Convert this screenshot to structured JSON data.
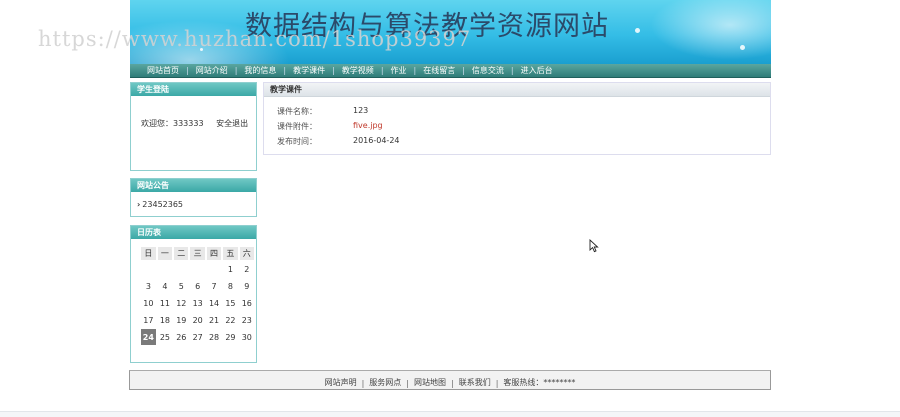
{
  "banner": {
    "title": "数据结构与算法教学资源网站"
  },
  "watermark": "https://www.huzhan.com/1shop39397",
  "nav": {
    "items": [
      "网站首页",
      "网站介绍",
      "我的信息",
      "教学课件",
      "教学视频",
      "作业",
      "在线留言",
      "信息交流",
      "进入后台"
    ]
  },
  "login": {
    "title": "学生登陆",
    "welcome": "欢迎您：333333",
    "logout": "安全退出"
  },
  "notice": {
    "title": "网站公告",
    "item": "23452365"
  },
  "calendar": {
    "title": "日历表",
    "weekdays": [
      "日",
      "一",
      "二",
      "三",
      "四",
      "五",
      "六"
    ],
    "weeks": [
      [
        "",
        "",
        "",
        "",
        "",
        "1",
        "2"
      ],
      [
        "3",
        "4",
        "5",
        "6",
        "7",
        "8",
        "9"
      ],
      [
        "10",
        "11",
        "12",
        "13",
        "14",
        "15",
        "16"
      ],
      [
        "17",
        "18",
        "19",
        "20",
        "21",
        "22",
        "23"
      ],
      [
        "24",
        "25",
        "26",
        "27",
        "28",
        "29",
        "30"
      ]
    ],
    "today": "24"
  },
  "main": {
    "title": "教学课件",
    "fields": [
      {
        "label": "课件名称：",
        "value": "123"
      },
      {
        "label": "课件附件：",
        "value": "five.jpg"
      },
      {
        "label": "发布时间：",
        "value": "2016-04-24"
      }
    ]
  },
  "footer": {
    "items": [
      "网站声明",
      "服务网点",
      "网站地图",
      "联系我们",
      "客服热线：********"
    ]
  },
  "colors": {
    "nav": "#2f7c78",
    "header": "#3ba8a6",
    "link": "#c0392b"
  }
}
